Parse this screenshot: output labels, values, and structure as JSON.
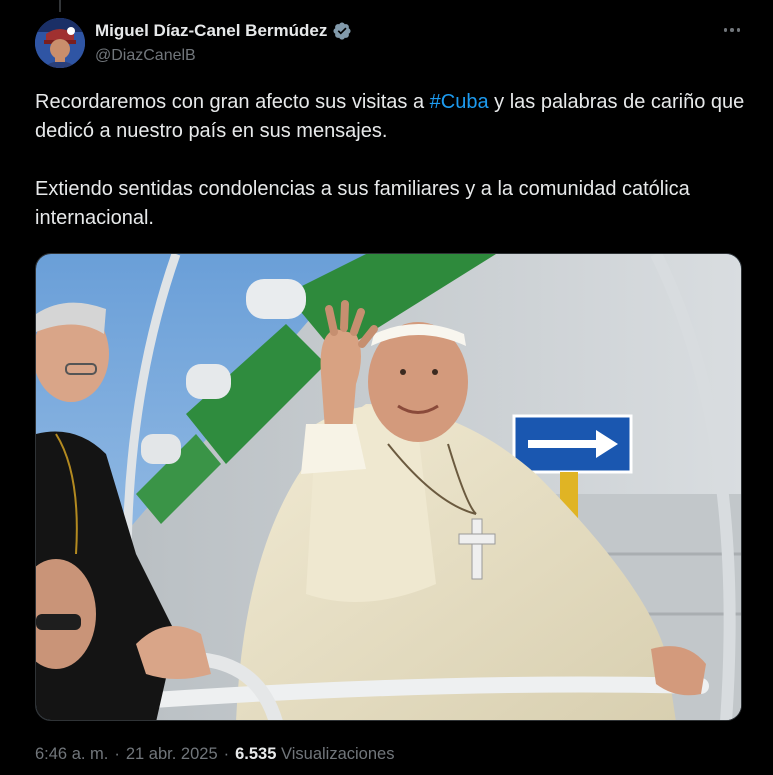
{
  "author": {
    "display_name": "Miguel Díaz-Canel Bermúdez",
    "handle": "@DiazCanelB",
    "verified_icon": "verified-badge-icon"
  },
  "tweet": {
    "text_part1": "Recordaremos con gran afecto sus visitas a ",
    "hashtag": "#Cuba",
    "text_part2": " y las palabras de cariño que dedicó a nuestro país en sus mensajes.",
    "paragraph2": "Extiendo sentidas condolencias a sus familiares y a la comunidad católica internacional."
  },
  "meta": {
    "time": "6:46 a. m.",
    "separator": "·",
    "date": "21 abr. 2025",
    "views_count": "6.535",
    "views_label": "Visualizaciones"
  },
  "colors": {
    "background": "#000000",
    "text": "#e7e9ea",
    "secondary": "#71767b",
    "link": "#1d9bf0",
    "verified": "#829aab"
  }
}
